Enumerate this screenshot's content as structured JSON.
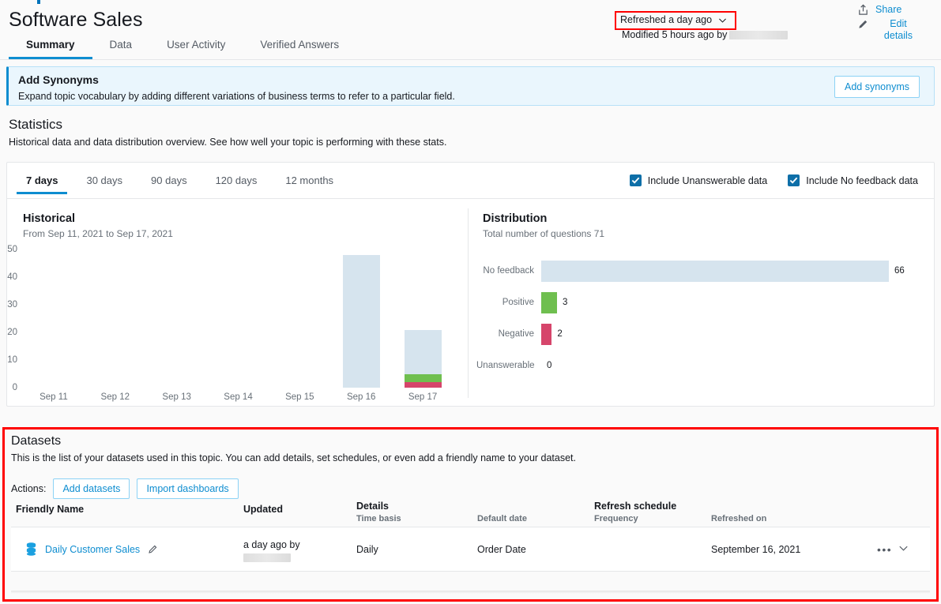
{
  "header": {
    "title": "Software Sales",
    "tabs": [
      {
        "label": "Summary",
        "active": true
      },
      {
        "label": "Data",
        "active": false
      },
      {
        "label": "User Activity",
        "active": false
      },
      {
        "label": "Verified Answers",
        "active": false
      }
    ],
    "refreshed_label": "Refreshed a day ago",
    "modified_label": "Modified 5 hours ago by",
    "share_label": "Share",
    "edit_details_label": "Edit details"
  },
  "synonyms": {
    "title": "Add Synonyms",
    "description": "Expand topic vocabulary by adding different variations of business terms to refer to a particular field.",
    "button_label": "Add synonyms"
  },
  "statistics": {
    "title": "Statistics",
    "description": "Historical data and data distribution overview. See how well your topic is performing with these stats.",
    "range_tabs": [
      {
        "label": "7 days",
        "active": true
      },
      {
        "label": "30 days",
        "active": false
      },
      {
        "label": "90 days",
        "active": false
      },
      {
        "label": "120 days",
        "active": false
      },
      {
        "label": "12 months",
        "active": false
      }
    ],
    "checkboxes": [
      {
        "label": "Include Unanswerable data",
        "checked": true
      },
      {
        "label": "Include No feedback data",
        "checked": true
      }
    ]
  },
  "chart_data": [
    {
      "type": "bar",
      "title": "Historical",
      "subtitle": "From Sep 11, 2021 to Sep 17, 2021",
      "categories": [
        "Sep 11",
        "Sep 12",
        "Sep 13",
        "Sep 14",
        "Sep 15",
        "Sep 16",
        "Sep 17"
      ],
      "series": [
        {
          "name": "Negative",
          "color": "#d6456b",
          "values": [
            0,
            0,
            0,
            0,
            0,
            0,
            2
          ]
        },
        {
          "name": "Positive",
          "color": "#6fbf4f",
          "values": [
            0,
            0,
            0,
            0,
            0,
            0,
            3
          ]
        },
        {
          "name": "No feedback",
          "color": "#d6e4ee",
          "values": [
            0,
            0,
            0,
            0,
            0,
            48,
            16
          ]
        }
      ],
      "stacked": true,
      "xlabel": "",
      "ylabel": "",
      "ylim": [
        0,
        50
      ],
      "yticks": [
        50,
        40,
        30,
        20,
        10,
        0
      ],
      "grid": false,
      "legend": "none"
    },
    {
      "type": "bar",
      "orientation": "horizontal",
      "title": "Distribution",
      "subtitle": "Total number of questions 71",
      "categories": [
        "No feedback",
        "Positive",
        "Negative",
        "Unanswerable"
      ],
      "values": [
        66,
        3,
        2,
        0
      ],
      "colors": [
        "#d6e4ee",
        "#6fbf4f",
        "#d6456b",
        "#d6e4ee"
      ],
      "value_labels": [
        "66",
        "3",
        "2",
        "0"
      ],
      "xlim": [
        0,
        66
      ],
      "grid": false,
      "legend": "none"
    }
  ],
  "datasets": {
    "title": "Datasets",
    "description": "This is the list of your datasets used in this topic. You can add details, set schedules, or even add a friendly name to your dataset.",
    "actions_label": "Actions:",
    "add_datasets_label": "Add datasets",
    "import_dashboards_label": "Import dashboards",
    "columns": {
      "friendly_name": "Friendly Name",
      "updated": "Updated",
      "details": "Details",
      "time_basis": "Time basis",
      "default_date": "Default date",
      "refresh_schedule": "Refresh schedule",
      "frequency": "Frequency",
      "refreshed_on": "Refreshed on"
    },
    "rows": [
      {
        "name": "Daily Customer Sales",
        "updated": "a day ago by",
        "time_basis": "Daily",
        "default_date": "Order Date",
        "frequency": "",
        "refreshed_on": "September 16, 2021"
      }
    ]
  },
  "colors": {
    "accent": "#0e8dd0",
    "no_feedback": "#d6e4ee",
    "positive": "#6fbf4f",
    "negative": "#d6456b",
    "annotation": "#ff0000"
  }
}
